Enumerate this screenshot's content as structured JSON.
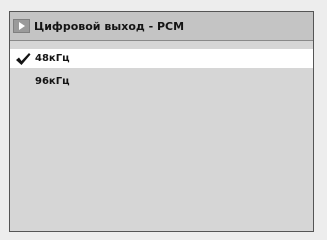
{
  "menu": {
    "title": "Цифровой выход - PCM",
    "items": [
      {
        "label": "48кГц",
        "checked": true,
        "selected": true
      },
      {
        "label": "96кГц",
        "checked": false,
        "selected": false
      }
    ]
  },
  "icons": {
    "header_icon": "play-icon",
    "check_icon": "check-icon"
  },
  "colors": {
    "background": "#d6d6d6",
    "header_bg": "#c4c4c4",
    "selection": "#ffffff",
    "text": "#141414"
  }
}
